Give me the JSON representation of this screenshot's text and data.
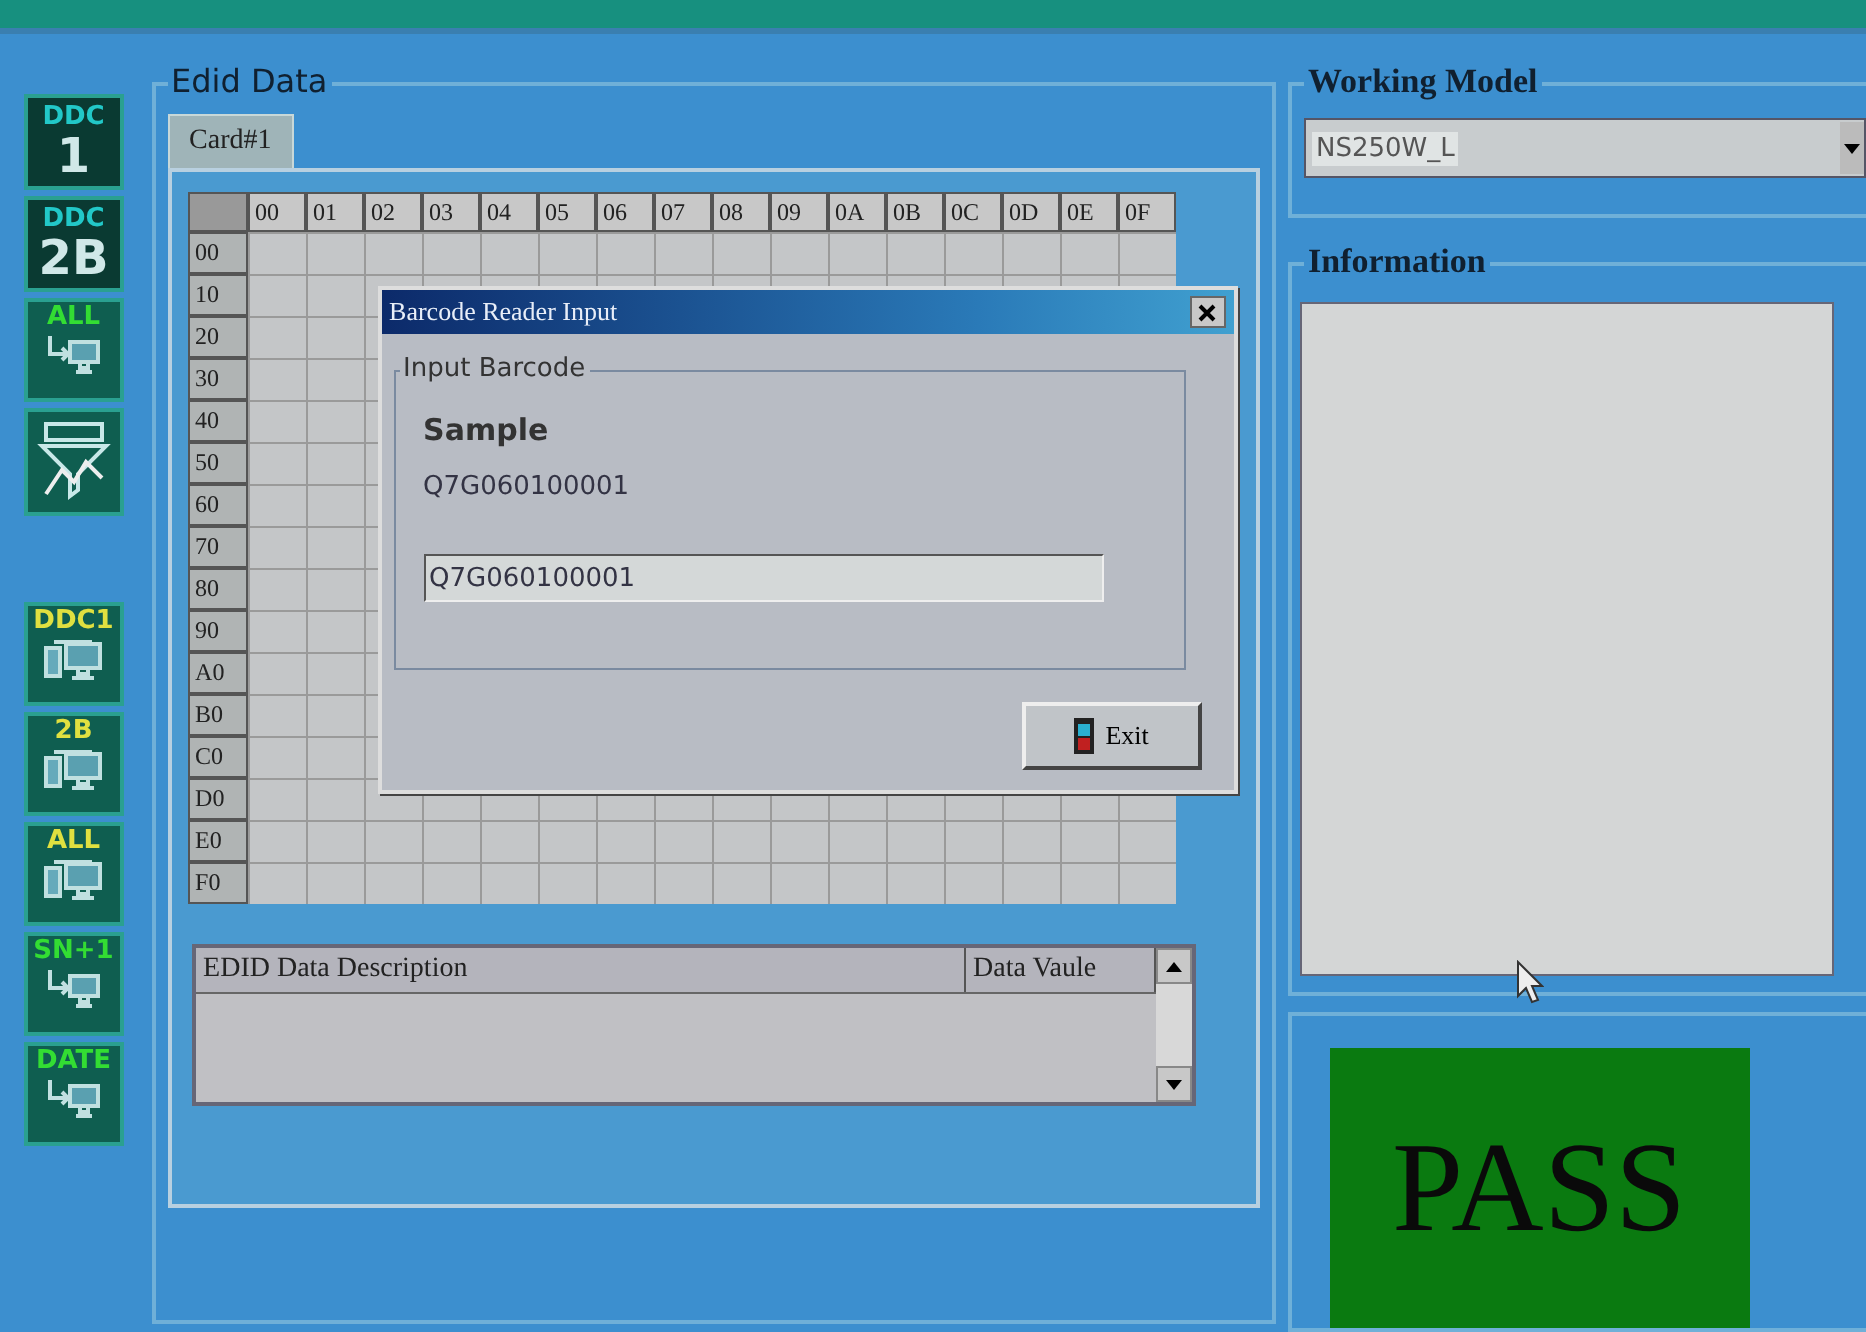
{
  "toolbar": [
    {
      "kind": "number",
      "label": "DDC",
      "big": "1",
      "color": "#22c8c8"
    },
    {
      "kind": "number",
      "label": "DDC",
      "big": "2B",
      "color": "#22c8c8"
    },
    {
      "kind": "transfer",
      "label": "ALL",
      "color": "#33dd33"
    },
    {
      "kind": "graph"
    },
    {
      "kind": "device",
      "label": "DDC1",
      "color": "#e0e040"
    },
    {
      "kind": "device",
      "label": "2B",
      "color": "#e0e040"
    },
    {
      "kind": "device",
      "label": "ALL",
      "color": "#e0e040"
    },
    {
      "kind": "transfer",
      "label": "SN+1",
      "color": "#33dd33"
    },
    {
      "kind": "transfer",
      "label": "DATE",
      "color": "#33dd33"
    }
  ],
  "edid": {
    "title": "Edid Data",
    "tabs": [
      {
        "label": "Card#1",
        "selected": true
      }
    ],
    "columns": [
      "00",
      "01",
      "02",
      "03",
      "04",
      "05",
      "06",
      "07",
      "08",
      "09",
      "0A",
      "0B",
      "0C",
      "0D",
      "0E",
      "0F"
    ],
    "rows": [
      "00",
      "10",
      "20",
      "30",
      "40",
      "50",
      "60",
      "70",
      "80",
      "90",
      "A0",
      "B0",
      "C0",
      "D0",
      "E0",
      "F0"
    ],
    "list_columns": [
      "EDID Data Description",
      "Data Vaule"
    ]
  },
  "dialog": {
    "title": "Barcode Reader Input",
    "group": "Input Barcode",
    "label": "Sample",
    "sample": "Q7G060100001",
    "input": "Q7G060100001",
    "button": "Exit"
  },
  "working_model": {
    "title": "Working Model",
    "value": "NS250W_L"
  },
  "information": {
    "title": "Information"
  },
  "result": {
    "text": "PASS"
  }
}
